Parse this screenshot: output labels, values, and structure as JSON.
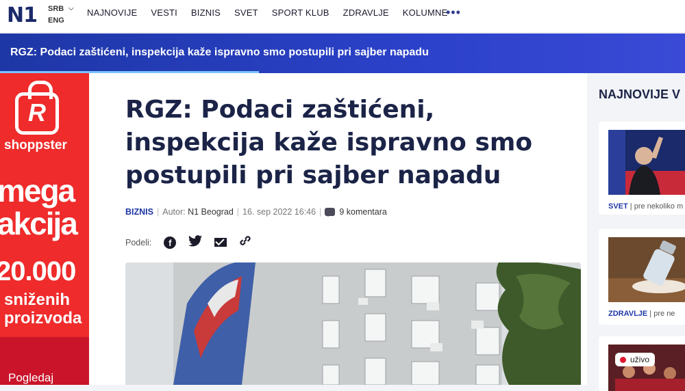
{
  "nav": {
    "logo": "N1",
    "lang_primary": "SRB",
    "lang_secondary": "ENG",
    "items": [
      "NAJNOVIJE",
      "VESTI",
      "BIZNIS",
      "SVET",
      "SPORT KLUB",
      "ZDRAVLJE",
      "KOLUMNE"
    ],
    "more": "•••"
  },
  "banner": {
    "headline": "RGZ: Podaci zaštićeni, inspekcija kaže ispravno smo postupili pri sajber napadu"
  },
  "ad": {
    "brand": "shoppster",
    "line1": "mega",
    "line2": "akcija",
    "number": "20.000",
    "line3": "sniženih",
    "line4": "proizvoda",
    "cta": "Pogledaj"
  },
  "article": {
    "title": "RGZ: Podaci zaštićeni, inspekcija kaže ispravno smo postupili pri sajber napadu",
    "category": "BIZNIS",
    "author_label": "Autor:",
    "author": "N1 Beograd",
    "date": "16. sep 2022 16:46",
    "comments": "9 komentara",
    "share_label": "Podeli:"
  },
  "sidebar": {
    "title": "NAJNOVIJE V",
    "cards": [
      {
        "category": "SVET",
        "time": "pre nekoliko m"
      },
      {
        "category": "ZDRAVLJE",
        "time": "pre ne"
      },
      {
        "live": "uživo"
      }
    ]
  },
  "colors": {
    "brand_blue": "#1e37a6",
    "ad_red": "#ef2b2b"
  }
}
